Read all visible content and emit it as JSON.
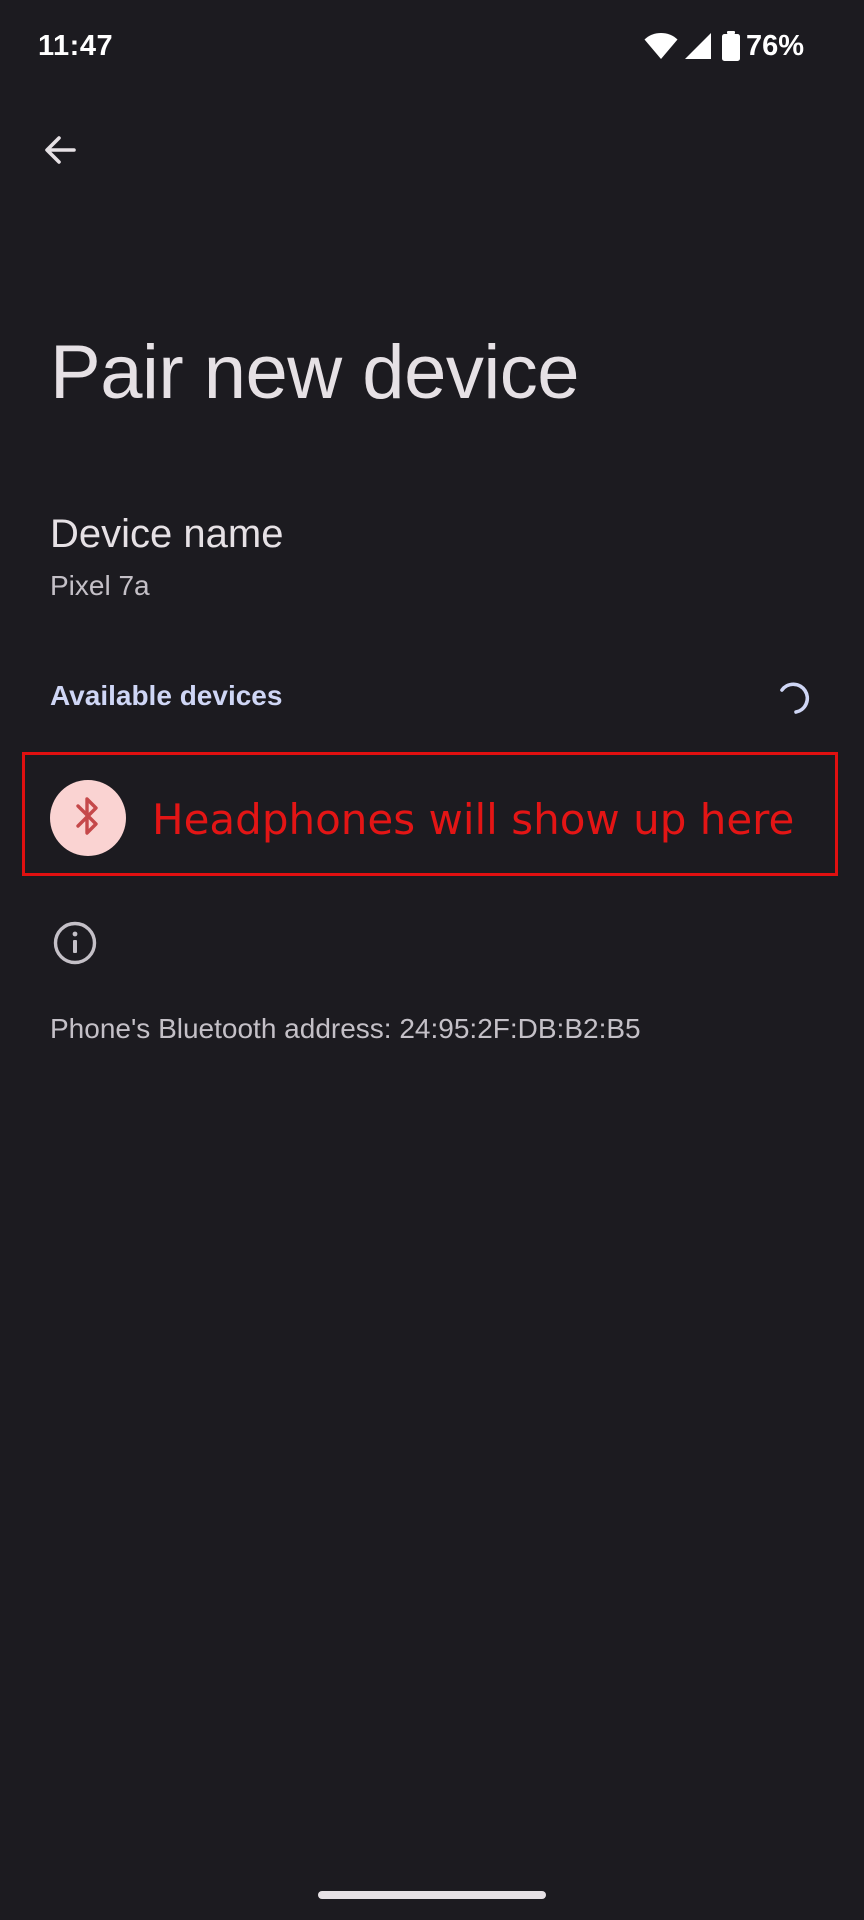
{
  "status_bar": {
    "time": "11:47",
    "battery_percent": "76%",
    "icons": [
      "wifi-icon",
      "cellular-signal-icon",
      "battery-icon"
    ]
  },
  "header": {
    "back_icon": "arrow-back-icon",
    "title": "Pair new device"
  },
  "device_name": {
    "title": "Device name",
    "value": "Pixel 7a"
  },
  "available_devices": {
    "header": "Available devices",
    "loading_icon": "progress-spinner-icon",
    "annotation_text": "Headphones will show up here",
    "annotation_color": "#e01010",
    "bluetooth_icon": "bluetooth-icon"
  },
  "footer_info": {
    "icon": "info-icon",
    "bluetooth_address": "Phone's Bluetooth address: 24:95:2F:DB:B2:B5"
  },
  "colors": {
    "background": "#1c1b20",
    "accent_header": "#cfd6f5",
    "bluetooth_circle": "#fad3d2"
  }
}
